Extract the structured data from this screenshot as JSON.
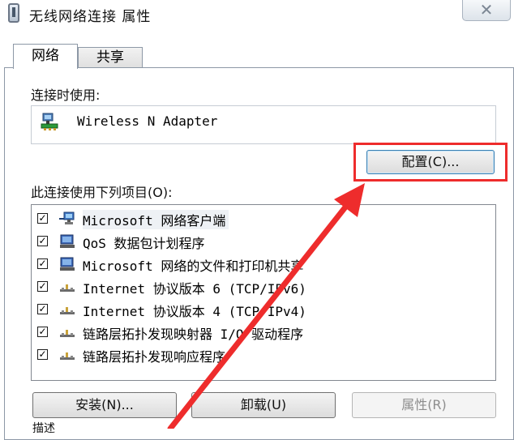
{
  "window": {
    "title": "无线网络连接 属性",
    "close_glyph": "✕"
  },
  "tabs": [
    {
      "label": "网络"
    },
    {
      "label": "共享"
    }
  ],
  "connect_using": {
    "label": "连接时使用:",
    "adapter_name": "Wireless N Adapter"
  },
  "configure_button": {
    "label": "配置(C)..."
  },
  "items_section": {
    "label": "此连接使用下列项目(O):",
    "items": [
      {
        "label": "Microsoft 网络客户端",
        "checked": true,
        "icon": "network-client-icon"
      },
      {
        "label": "QoS 数据包计划程序",
        "checked": true,
        "icon": "service-icon"
      },
      {
        "label": "Microsoft 网络的文件和打印机共享",
        "checked": true,
        "icon": "service-icon"
      },
      {
        "label": "Internet 协议版本 6 (TCP/IPv6)",
        "checked": true,
        "icon": "protocol-icon"
      },
      {
        "label": "Internet 协议版本 4 (TCP/IPv4)",
        "checked": true,
        "icon": "protocol-icon"
      },
      {
        "label": "链路层拓扑发现映射器 I/O 驱动程序",
        "checked": true,
        "icon": "protocol-icon"
      },
      {
        "label": "链路层拓扑发现响应程序",
        "checked": true,
        "icon": "protocol-icon"
      }
    ]
  },
  "buttons": {
    "install": "安装(N)...",
    "uninstall": "卸载(U)",
    "properties": "属性(R)"
  },
  "description_label": "描述",
  "colors": {
    "highlight_red": "#ee2c2c",
    "focus_blue": "#3c7fb1",
    "border_gray": "#8d98a6"
  }
}
